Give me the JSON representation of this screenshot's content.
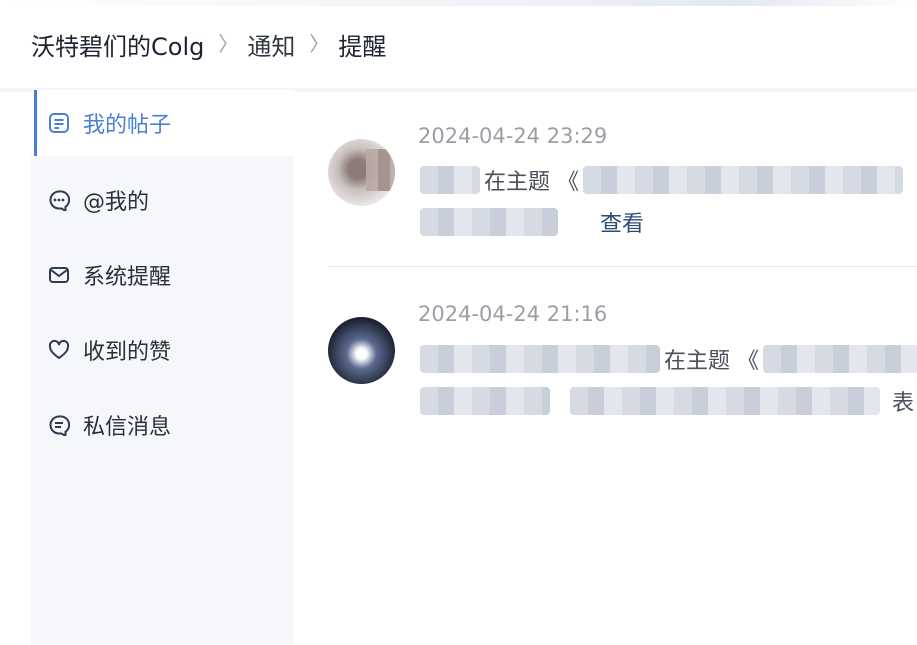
{
  "breadcrumb": {
    "site": "沃特碧们的Colg",
    "section": "通知",
    "page": "提醒",
    "separator": "〉"
  },
  "sidebar": {
    "items": [
      {
        "label": "我的帖子",
        "icon": "post-icon",
        "active": true
      },
      {
        "label": "@我的",
        "icon": "mention-icon",
        "active": false
      },
      {
        "label": "系统提醒",
        "icon": "mail-icon",
        "active": false
      },
      {
        "label": "收到的赞",
        "icon": "heart-icon",
        "active": false
      },
      {
        "label": "私信消息",
        "icon": "message-icon",
        "active": false
      }
    ]
  },
  "notifications": [
    {
      "time": "2024-04-24 23:29",
      "text_prefix": "在主题 《",
      "action": "查看"
    },
    {
      "time": "2024-04-24 21:16",
      "text_prefix": "在主题 《",
      "tail": "表"
    }
  ],
  "colors": {
    "accent": "#4a7fd6",
    "sidebar_bg": "#f6f7fb",
    "link": "#2d4a78",
    "muted_text": "#9b9ea5"
  }
}
